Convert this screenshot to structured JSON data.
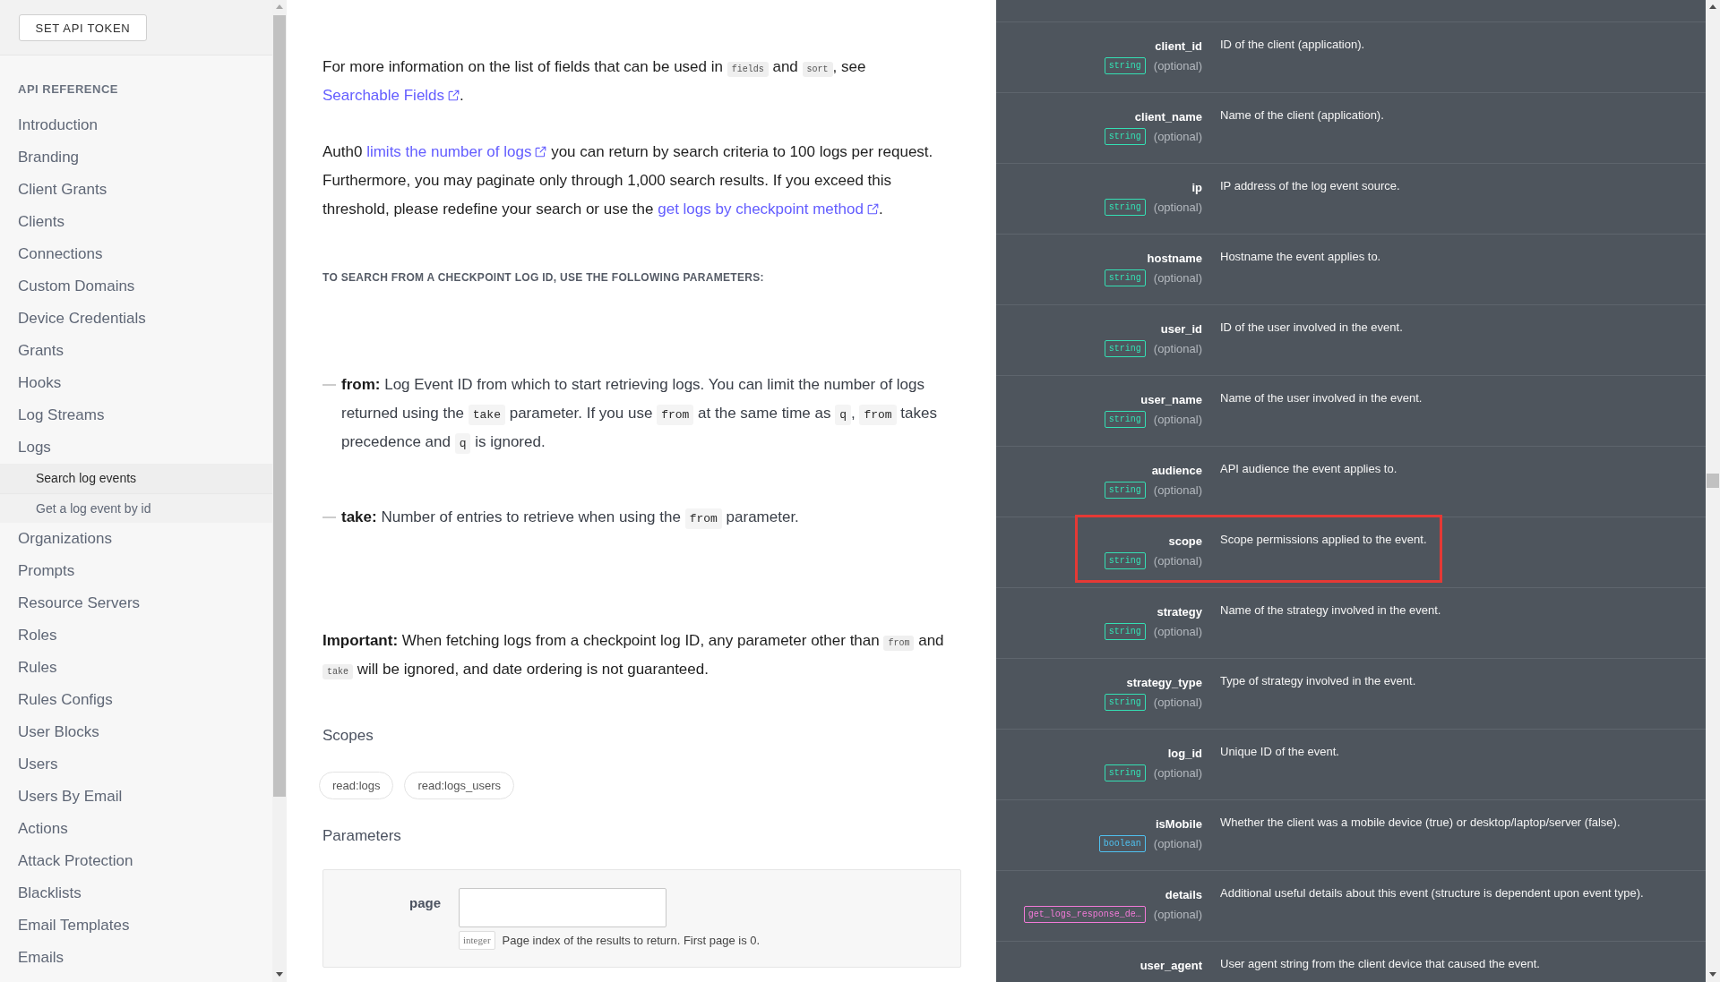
{
  "sidebar": {
    "button": "SET API TOKEN",
    "section_title": "API REFERENCE",
    "items": [
      {
        "label": "Introduction",
        "selected": false
      },
      {
        "label": "Branding",
        "selected": false
      },
      {
        "label": "Client Grants",
        "selected": false
      },
      {
        "label": "Clients",
        "selected": false
      },
      {
        "label": "Connections",
        "selected": false
      },
      {
        "label": "Custom Domains",
        "selected": false
      },
      {
        "label": "Device Credentials",
        "selected": false
      },
      {
        "label": "Grants",
        "selected": false
      },
      {
        "label": "Hooks",
        "selected": false
      },
      {
        "label": "Log Streams",
        "selected": false
      },
      {
        "label": "Logs",
        "selected": false,
        "children": [
          {
            "label": "Search log events",
            "selected": true
          },
          {
            "label": "Get a log event by id",
            "selected": false
          }
        ]
      },
      {
        "label": "Organizations",
        "selected": false
      },
      {
        "label": "Prompts",
        "selected": false
      },
      {
        "label": "Resource Servers",
        "selected": false
      },
      {
        "label": "Roles",
        "selected": false
      },
      {
        "label": "Rules",
        "selected": false
      },
      {
        "label": "Rules Configs",
        "selected": false
      },
      {
        "label": "User Blocks",
        "selected": false
      },
      {
        "label": "Users",
        "selected": false
      },
      {
        "label": "Users By Email",
        "selected": false
      },
      {
        "label": "Actions",
        "selected": false
      },
      {
        "label": "Attack Protection",
        "selected": false
      },
      {
        "label": "Blacklists",
        "selected": false
      },
      {
        "label": "Email Templates",
        "selected": false
      },
      {
        "label": "Emails",
        "selected": false
      }
    ]
  },
  "content": {
    "blocks": [
      {
        "kind": "paragraph",
        "parts": [
          {
            "kind": "text",
            "text": "For more information on the list of fields that can be used in "
          },
          {
            "kind": "code",
            "text": "fields"
          },
          {
            "kind": "text",
            "text": " and "
          },
          {
            "kind": "code",
            "text": "sort"
          },
          {
            "kind": "text",
            "text": ", see "
          },
          {
            "kind": "link",
            "text": "Searchable Fields"
          },
          {
            "kind": "text",
            "text": "."
          }
        ]
      },
      {
        "kind": "paragraph",
        "parts": [
          {
            "kind": "text",
            "text": "Auth0 "
          },
          {
            "kind": "link",
            "text": "limits the number of logs"
          },
          {
            "kind": "text",
            "text": " you can return by search criteria to 100 logs per request. Furthermore, you may paginate only through 1,000 search results. If you exceed this threshold, please redefine your search or use the "
          },
          {
            "kind": "link",
            "text": "get logs by checkpoint method"
          },
          {
            "kind": "text",
            "text": "."
          }
        ]
      },
      {
        "kind": "heading",
        "text": "TO SEARCH FROM A CHECKPOINT LOG ID, USE THE FOLLOWING PARAMETERS:"
      },
      {
        "kind": "bullet",
        "parts": [
          {
            "kind": "bold",
            "text": "from:"
          },
          {
            "kind": "text",
            "text": " Log Event ID from which to start retrieving logs. You can limit the number of logs returned using the "
          },
          {
            "kind": "code",
            "text": "take"
          },
          {
            "kind": "text",
            "text": " parameter. If you use "
          },
          {
            "kind": "code",
            "text": "from"
          },
          {
            "kind": "text",
            "text": " at the same time as "
          },
          {
            "kind": "code",
            "text": "q"
          },
          {
            "kind": "text",
            "text": ", "
          },
          {
            "kind": "code",
            "text": "from"
          },
          {
            "kind": "text",
            "text": " takes precedence and "
          },
          {
            "kind": "code",
            "text": "q"
          },
          {
            "kind": "text",
            "text": " is ignored."
          }
        ]
      },
      {
        "kind": "bullet",
        "parts": [
          {
            "kind": "bold",
            "text": "take:"
          },
          {
            "kind": "text",
            "text": " Number of entries to retrieve when using the "
          },
          {
            "kind": "code",
            "text": "from"
          },
          {
            "kind": "text",
            "text": " parameter."
          }
        ]
      },
      {
        "kind": "paragraph",
        "parts": [
          {
            "kind": "bold",
            "text": "Important:"
          },
          {
            "kind": "text",
            "text": " When fetching logs from a checkpoint log ID, any parameter other than "
          },
          {
            "kind": "code",
            "text": "from"
          },
          {
            "kind": "text",
            "text": " and "
          },
          {
            "kind": "code",
            "text": "take"
          },
          {
            "kind": "text",
            "text": " will be ignored, and date ordering is not guaranteed."
          }
        ]
      }
    ],
    "scopes": {
      "title": "Scopes",
      "items": [
        "read:logs",
        "read:logs_users"
      ]
    },
    "parameters": {
      "title": "Parameters",
      "items": [
        {
          "name": "page",
          "type": "integer",
          "description": "Page index of the results to return. First page is 0."
        }
      ]
    }
  },
  "fields": [
    {
      "name": "client_id",
      "type": "string",
      "color": "#34e0b4",
      "note": "(optional)",
      "description": "ID of the client (application).",
      "highlighted": false
    },
    {
      "name": "client_name",
      "type": "string",
      "color": "#34e0b4",
      "note": "(optional)",
      "description": "Name of the client (application).",
      "highlighted": false
    },
    {
      "name": "ip",
      "type": "string",
      "color": "#34e0b4",
      "note": "(optional)",
      "description": "IP address of the log event source.",
      "highlighted": false
    },
    {
      "name": "hostname",
      "type": "string",
      "color": "#34e0b4",
      "note": "(optional)",
      "description": "Hostname the event applies to.",
      "highlighted": false
    },
    {
      "name": "user_id",
      "type": "string",
      "color": "#34e0b4",
      "note": "(optional)",
      "description": "ID of the user involved in the event.",
      "highlighted": false
    },
    {
      "name": "user_name",
      "type": "string",
      "color": "#34e0b4",
      "note": "(optional)",
      "description": "Name of the user involved in the event.",
      "highlighted": false
    },
    {
      "name": "audience",
      "type": "string",
      "color": "#34e0b4",
      "note": "(optional)",
      "description": "API audience the event applies to.",
      "highlighted": false
    },
    {
      "name": "scope",
      "type": "string",
      "color": "#34e0b4",
      "note": "(optional)",
      "description": "Scope permissions applied to the event.",
      "highlighted": true
    },
    {
      "name": "strategy",
      "type": "string",
      "color": "#34e0b4",
      "note": "(optional)",
      "description": "Name of the strategy involved in the event.",
      "highlighted": false
    },
    {
      "name": "strategy_type",
      "type": "string",
      "color": "#34e0b4",
      "note": "(optional)",
      "description": "Type of strategy involved in the event.",
      "highlighted": false
    },
    {
      "name": "log_id",
      "type": "string",
      "color": "#34e0b4",
      "note": "(optional)",
      "description": "Unique ID of the event.",
      "highlighted": false
    },
    {
      "name": "isMobile",
      "type": "boolean",
      "color": "#4fc1f0",
      "note": "(optional)",
      "description": "Whether the client was a mobile device (true) or desktop/laptop/server (false).",
      "highlighted": false
    },
    {
      "name": "details",
      "type": "get_logs_response_de…",
      "color": "#f27ad8",
      "note": "(optional)",
      "description": "Additional useful details about this event (structure is dependent upon event type).",
      "highlighted": false
    },
    {
      "name": "user_agent",
      "description": "User agent string from the client device that caused the event.",
      "highlighted": false
    }
  ]
}
